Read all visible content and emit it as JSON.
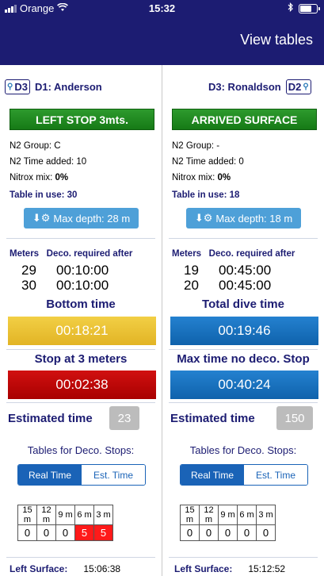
{
  "status_bar": {
    "carrier": "Orange",
    "time": "15:32"
  },
  "header": {
    "view_tables": "View tables"
  },
  "left": {
    "code": "D3",
    "diver": "D1: Anderson",
    "status": "LEFT STOP 3mts.",
    "n2_group": "N2 Group:  C",
    "n2_time": "N2 Time added: 10",
    "nitrox_label": "Nitrox mix: ",
    "nitrox_value": "0%",
    "table_in_use": "Table in use: 30",
    "max_depth": "Max depth: 28 m",
    "meters_header": "Meters",
    "deco_header": "Deco. required after",
    "deco_rows": [
      {
        "m": "29",
        "t": "00:10:00"
      },
      {
        "m": "30",
        "t": "00:10:00"
      }
    ],
    "time1_title": "Bottom time",
    "time1_value": "00:18:21",
    "time2_title": "Stop at 3 meters",
    "time2_value": "00:02:38",
    "est_label": "Estimated time",
    "est_value": "23",
    "tables_title": "Tables for Deco. Stops:",
    "seg_real": "Real Time",
    "seg_est": "Est. Time",
    "table_headers": [
      "15 m",
      "12 m",
      "9 m",
      "6 m",
      "3 m"
    ],
    "table_values": [
      "0",
      "0",
      "0",
      "5",
      "5"
    ],
    "surface_label": "Left Surface:",
    "surface_time": "15:06:38"
  },
  "right": {
    "code": "D2",
    "diver": "D3: Ronaldson",
    "status": "ARRIVED SURFACE",
    "n2_group": "N2 Group:  -",
    "n2_time": "N2 Time added: 0",
    "nitrox_label": "Nitrox mix: ",
    "nitrox_value": "0%",
    "table_in_use": "Table in use: 18",
    "max_depth": "Max depth: 18 m",
    "meters_header": "Meters",
    "deco_header": "Deco. required after",
    "deco_rows": [
      {
        "m": "19",
        "t": "00:45:00"
      },
      {
        "m": "20",
        "t": "00:45:00"
      }
    ],
    "time1_title": "Total dive time",
    "time1_value": "00:19:46",
    "time2_title": "Max time no deco. Stop",
    "time2_value": "00:40:24",
    "est_label": "Estimated time",
    "est_value": "150",
    "tables_title": "Tables for Deco. Stops:",
    "seg_real": "Real Time",
    "seg_est": "Est. Time",
    "table_headers": [
      "15 m",
      "12 m",
      "9 m",
      "6 m",
      "3 m"
    ],
    "table_values": [
      "0",
      "0",
      "0",
      "0",
      "0"
    ],
    "surface_label": "Left Surface:",
    "surface_time": "15:12:52"
  },
  "colors": {
    "header_bg": "#1c1c72",
    "status_green": "#1f8a1f",
    "yellow": "#e8c030",
    "red": "#c10000",
    "blue": "#1873c2",
    "alert": "#ff1a1a"
  }
}
